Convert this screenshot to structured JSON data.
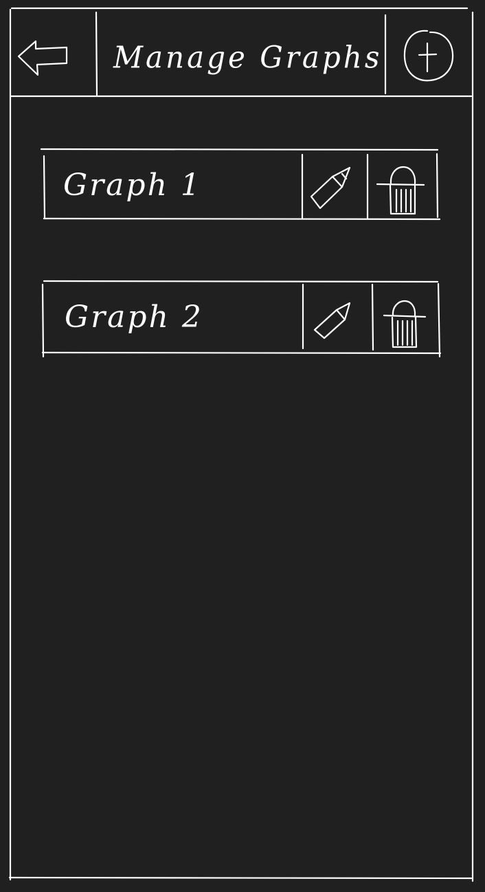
{
  "header": {
    "title": "Manage Graphs",
    "back_icon": "back-arrow-icon",
    "add_icon": "plus-circle-icon"
  },
  "graphs": [
    {
      "label": "Graph 1",
      "edit_icon": "pencil-icon",
      "delete_icon": "trash-icon"
    },
    {
      "label": "Graph 2",
      "edit_icon": "pencil-icon",
      "delete_icon": "trash-icon"
    }
  ],
  "colors": {
    "background": "#202020",
    "stroke": "#ffffff"
  }
}
